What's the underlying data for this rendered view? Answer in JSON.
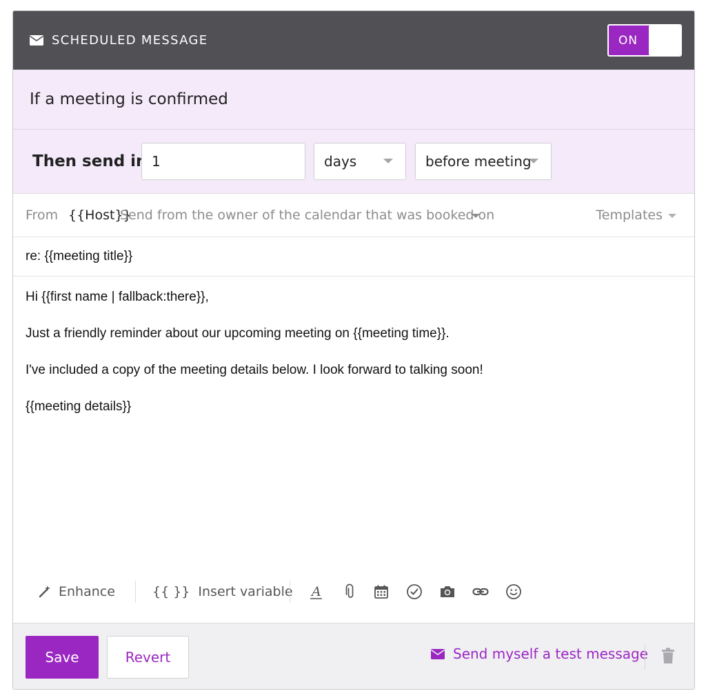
{
  "header": {
    "title": "SCHEDULED MESSAGE",
    "icon": "envelope-icon",
    "toggle_label": "ON",
    "toggle_on": true
  },
  "condition": {
    "text": "If a meeting is confirmed"
  },
  "send_in": {
    "label": "Then send in",
    "amount": "1",
    "unit": "days",
    "relation": "before meeting"
  },
  "from": {
    "label": "From",
    "host": "{{Host}}",
    "description": "Send from the owner of the calendar that was booked on",
    "templates_label": "Templates"
  },
  "subject": "re: {{meeting title}}",
  "body": {
    "lines": [
      "Hi {{first name | fallback:there}},",
      "Just a friendly reminder about our upcoming meeting on {{meeting time}}.",
      "I've included a copy of the meeting details below. I look forward to talking soon!",
      "{{meeting details}}"
    ]
  },
  "toolbar": {
    "enhance_label": "Enhance",
    "variable_braces": "{{ }}",
    "variable_label": "Insert variable",
    "icons": [
      "text-format-icon",
      "attachment-icon",
      "calendar-icon",
      "check-circle-icon",
      "camera-icon",
      "link-icon",
      "emoji-icon"
    ]
  },
  "footer": {
    "save_label": "Save",
    "revert_label": "Revert",
    "test_label": "Send myself a test message"
  },
  "colors": {
    "accent": "#9b27c2",
    "header_bg": "#515155",
    "condition_bg": "#f4eafa"
  }
}
